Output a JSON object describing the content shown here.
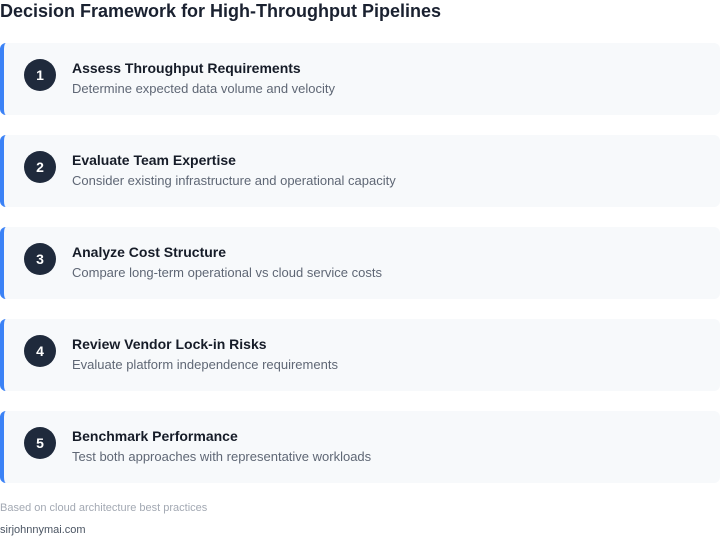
{
  "header": {
    "title": "Decision Framework for High-Throughput Pipelines"
  },
  "steps": [
    {
      "number": "1",
      "title": "Assess Throughput Requirements",
      "description": "Determine expected data volume and velocity"
    },
    {
      "number": "2",
      "title": "Evaluate Team Expertise",
      "description": "Consider existing infrastructure and operational capacity"
    },
    {
      "number": "3",
      "title": "Analyze Cost Structure",
      "description": "Compare long-term operational vs cloud service costs"
    },
    {
      "number": "4",
      "title": "Review Vendor Lock-in Risks",
      "description": "Evaluate platform independence requirements"
    },
    {
      "number": "5",
      "title": "Benchmark Performance",
      "description": "Test both approaches with representative workloads"
    }
  ],
  "footer": {
    "note": "Based on cloud architecture best practices",
    "site": "sirjohnnymai.com"
  },
  "colors": {
    "accent": "#3b82f6",
    "badge": "#1f2a3c",
    "card_background": "#f7f9fb"
  }
}
